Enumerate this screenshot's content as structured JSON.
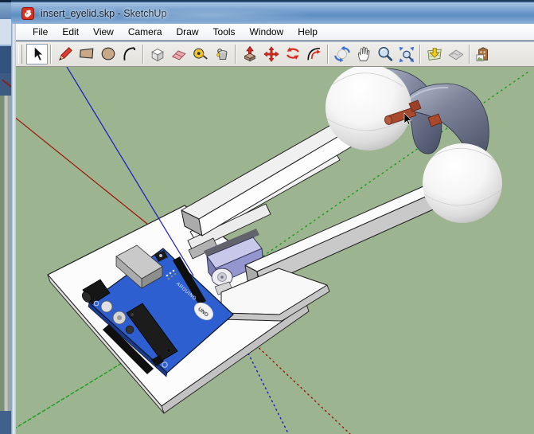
{
  "window": {
    "title": "insert_eyelid.skp - SketchUp"
  },
  "menu": {
    "items": [
      "File",
      "Edit",
      "View",
      "Camera",
      "Draw",
      "Tools",
      "Window",
      "Help"
    ]
  },
  "toolbar": {
    "active_tool": "Select",
    "tools": [
      "Select",
      "Line",
      "Rectangle",
      "Circle",
      "Arc",
      "Make Component",
      "Eraser",
      "Tape Measure",
      "Paint Bucket",
      "Push/Pull",
      "Move",
      "Rotate",
      "Offset",
      "Orbit",
      "Pan",
      "Zoom",
      "Zoom Extents",
      "Get Current View",
      "Toggle Terrain",
      "Photo Textures"
    ]
  },
  "viewport": {
    "background_color": "#9db491",
    "axes": {
      "red": "#9e1208",
      "green": "#0f9c12",
      "blue": "#1616c8"
    },
    "model": {
      "board_brand_text": "ARDUINO",
      "board_logo_text": "UNO",
      "parts": [
        "eyeball-spheres",
        "eyelid-shell",
        "eye-rails",
        "servo-motor",
        "arduino-uno-board",
        "base-plate"
      ]
    }
  }
}
